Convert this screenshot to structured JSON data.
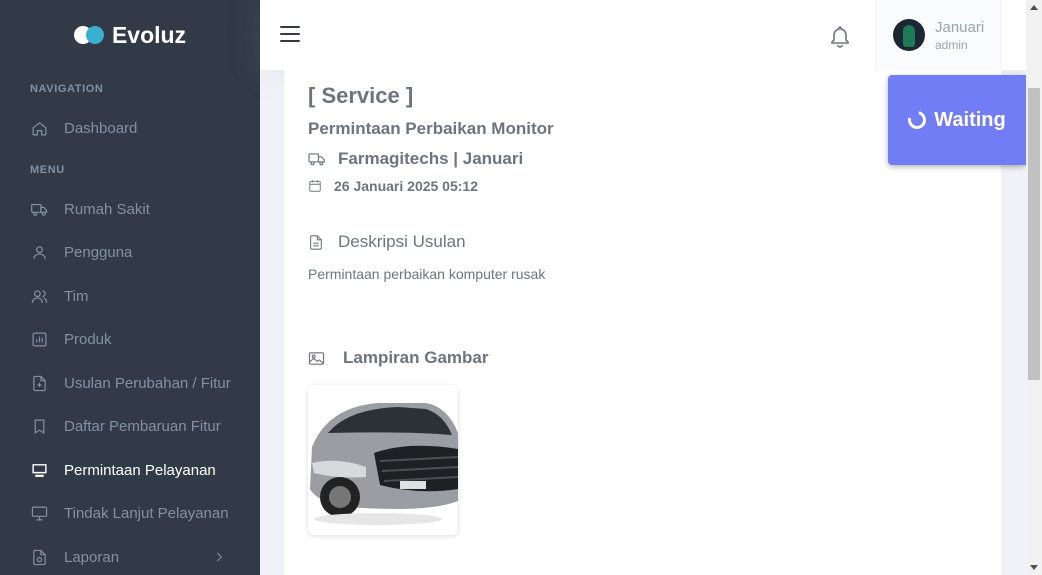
{
  "brand": {
    "name": "Evoluz"
  },
  "sidebar": {
    "section_navigation": "NAVIGATION",
    "section_menu": "MENU",
    "dashboard": {
      "label": "Dashboard",
      "icon": "home-icon"
    },
    "items": [
      {
        "label": "Rumah Sakit",
        "icon": "truck-icon"
      },
      {
        "label": "Pengguna",
        "icon": "user-icon"
      },
      {
        "label": "Tim",
        "icon": "users-icon"
      },
      {
        "label": "Produk",
        "icon": "bar-chart-icon"
      },
      {
        "label": "Usulan Perubahan / Fitur",
        "icon": "file-plus-icon"
      },
      {
        "label": "Daftar Pembaruan Fitur",
        "icon": "bookmark-icon"
      },
      {
        "label": "Permintaan Pelayanan",
        "icon": "monitor-icon",
        "active": true
      },
      {
        "label": "Tindak Lanjut Pelayanan",
        "icon": "monitor-icon"
      },
      {
        "label": "Laporan",
        "icon": "file-chart-icon"
      }
    ]
  },
  "topbar": {
    "menu_icon": "hamburger-icon",
    "notification_icon": "bell-icon",
    "user": {
      "name": "Januari",
      "role": "admin"
    }
  },
  "detail": {
    "type_label": "[ Service ]",
    "title": "Permintaan Perbaikan Monitor",
    "company": "Farmagitechs | Januari",
    "date": "26 Januari 2025 05:12",
    "description_heading": "Deskripsi Usulan",
    "description": "Permintaan perbaikan komputer rusak",
    "attachment_heading": "Lampiran Gambar"
  },
  "status": {
    "label": "Waiting",
    "color": "#727cf5"
  },
  "colors": {
    "sidebar_bg": "#313a46",
    "accent": "#727cf5",
    "brand_dot": "#39afd1"
  }
}
